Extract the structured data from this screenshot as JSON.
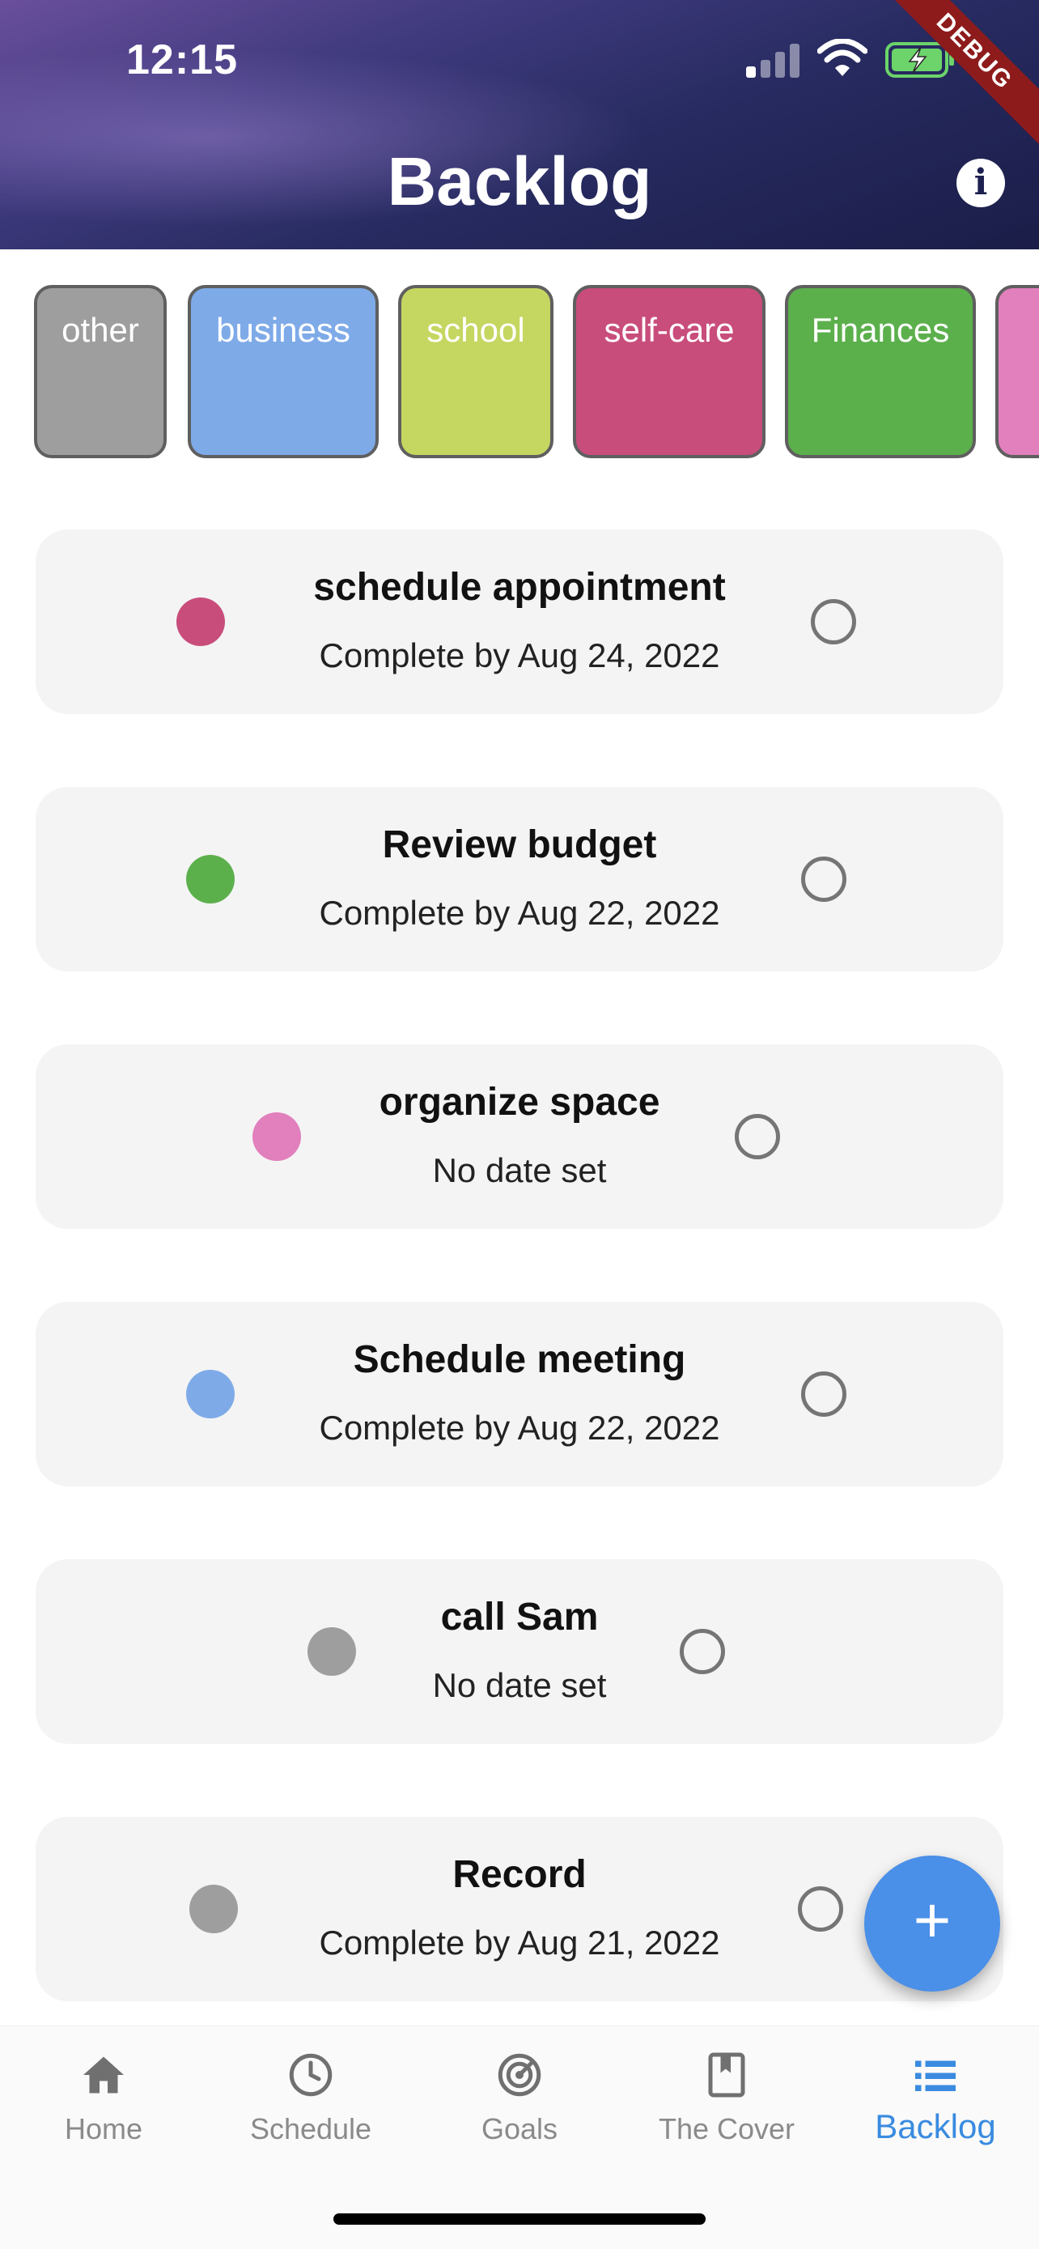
{
  "status_bar": {
    "time": "12:15",
    "debug_label": "DEBUG"
  },
  "app_bar": {
    "title": "Backlog",
    "info_icon": "info-icon"
  },
  "categories": [
    {
      "label": "other",
      "color": "#9e9e9e"
    },
    {
      "label": "business",
      "color": "#7eaae8"
    },
    {
      "label": "school",
      "color": "#c5d760"
    },
    {
      "label": "self-care",
      "color": "#c84d7b"
    },
    {
      "label": "Finances",
      "color": "#5cb04c"
    },
    {
      "label": "",
      "color": "#e27fbd"
    }
  ],
  "tasks": [
    {
      "title": "schedule appointment",
      "subtitle": "Complete by Aug 24, 2022",
      "color": "#c84d7b"
    },
    {
      "title": "Review budget",
      "subtitle": "Complete by Aug 22, 2022",
      "color": "#5cb04c"
    },
    {
      "title": "organize space",
      "subtitle": "No date set",
      "color": "#e27fbd"
    },
    {
      "title": "Schedule meeting",
      "subtitle": "Complete by Aug 22, 2022",
      "color": "#7eaae8"
    },
    {
      "title": "call Sam",
      "subtitle": "No date set",
      "color": "#9e9e9e"
    },
    {
      "title": "Record",
      "subtitle": "Complete by Aug 21, 2022",
      "color": "#9e9e9e"
    }
  ],
  "fab": {
    "icon": "plus-icon",
    "label": "+"
  },
  "bottom_nav": [
    {
      "label": "Home",
      "icon": "home-icon"
    },
    {
      "label": "Schedule",
      "icon": "clock-icon"
    },
    {
      "label": "Goals",
      "icon": "target-icon"
    },
    {
      "label": "The Cover",
      "icon": "book-icon"
    },
    {
      "label": "Backlog",
      "icon": "list-icon",
      "active": true
    }
  ],
  "colors": {
    "accent": "#3a8be0",
    "fab": "#4a8fe8"
  }
}
